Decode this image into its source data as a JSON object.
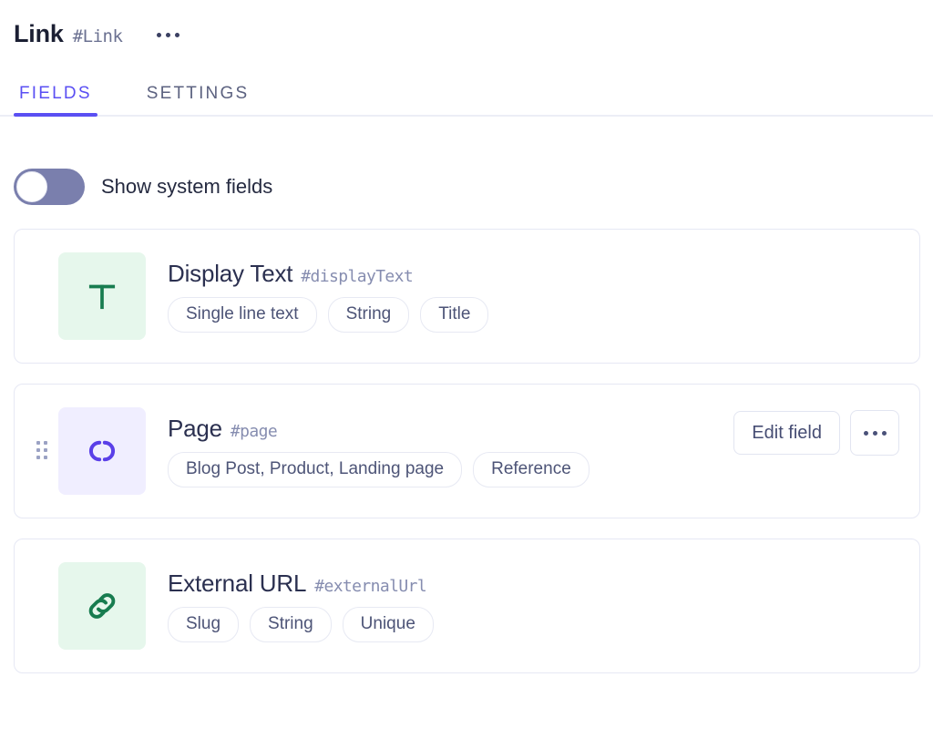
{
  "header": {
    "title": "Link",
    "id": "#Link",
    "menu_icon": "ellipsis-icon"
  },
  "tabs": [
    {
      "label": "FIELDS",
      "active": true
    },
    {
      "label": "SETTINGS",
      "active": false
    }
  ],
  "system_fields_toggle": {
    "label": "Show system fields",
    "checked": false
  },
  "colors": {
    "accent": "#5a4ff3",
    "icon_green_bg": "#e6f7ec",
    "icon_green_fg": "#177c4f",
    "icon_purple_bg": "#f0eeff",
    "icon_purple_fg": "#5a3fe8",
    "toggle_track": "#7a7fad",
    "card_border": "#e6e8f4",
    "text_primary": "#2b3050",
    "text_muted": "#868db0"
  },
  "row_actions": {
    "edit_label": "Edit field",
    "more_icon": "ellipsis-icon"
  },
  "fields": [
    {
      "title": "Display Text",
      "id": "#displayText",
      "icon": "text-t-icon",
      "icon_theme": "green",
      "pills": [
        "Single line text",
        "String",
        "Title"
      ],
      "hovered": false
    },
    {
      "title": "Page",
      "id": "#page",
      "icon": "link-rings-icon",
      "icon_theme": "purple",
      "pills": [
        "Blog Post, Product, Landing page",
        "Reference"
      ],
      "hovered": true
    },
    {
      "title": "External URL",
      "id": "#externalUrl",
      "icon": "chain-link-icon",
      "icon_theme": "green",
      "pills": [
        "Slug",
        "String",
        "Unique"
      ],
      "hovered": false
    }
  ]
}
